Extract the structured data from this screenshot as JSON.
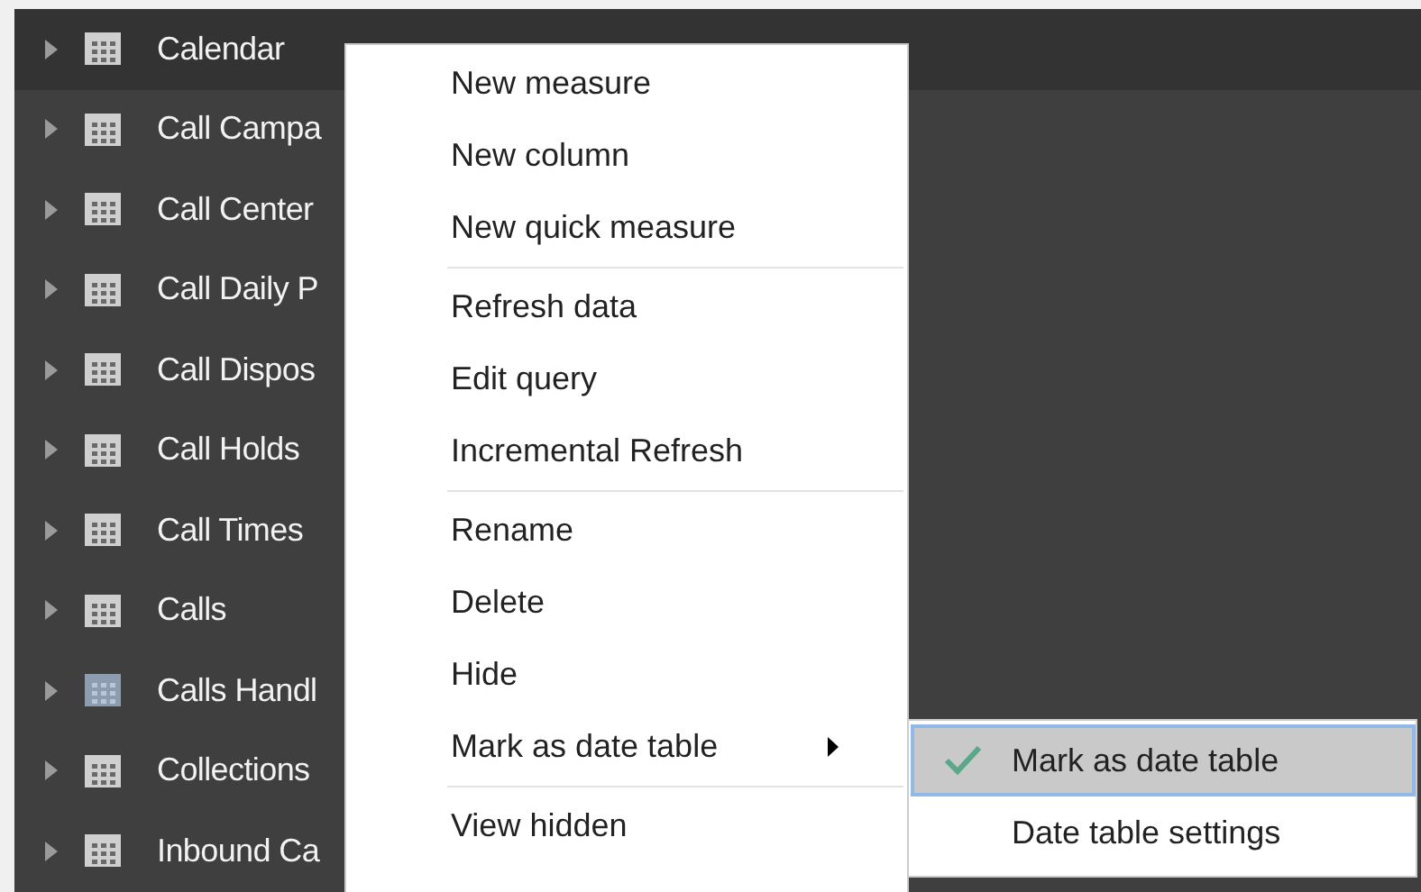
{
  "tables": [
    {
      "name": "Calendar",
      "selected": true,
      "hidden": false
    },
    {
      "name": "Call Campa",
      "selected": false,
      "hidden": false
    },
    {
      "name": "Call Center",
      "selected": false,
      "hidden": false
    },
    {
      "name": "Call Daily P",
      "selected": false,
      "hidden": false
    },
    {
      "name": "Call Dispos",
      "selected": false,
      "hidden": false
    },
    {
      "name": "Call Holds",
      "selected": false,
      "hidden": false
    },
    {
      "name": "Call Times",
      "selected": false,
      "hidden": false
    },
    {
      "name": "Calls",
      "selected": false,
      "hidden": false
    },
    {
      "name": "Calls Handl",
      "selected": false,
      "hidden": true
    },
    {
      "name": "Collections",
      "selected": false,
      "hidden": false
    },
    {
      "name": "Inbound Ca",
      "selected": false,
      "hidden": false
    }
  ],
  "context_menu": {
    "groups": [
      [
        {
          "label": "New measure",
          "has_submenu": false
        },
        {
          "label": "New column",
          "has_submenu": false
        },
        {
          "label": "New quick measure",
          "has_submenu": false
        }
      ],
      [
        {
          "label": "Refresh data",
          "has_submenu": false
        },
        {
          "label": "Edit query",
          "has_submenu": false
        },
        {
          "label": "Incremental Refresh",
          "has_submenu": false
        }
      ],
      [
        {
          "label": "Rename",
          "has_submenu": false
        },
        {
          "label": "Delete",
          "has_submenu": false
        },
        {
          "label": "Hide",
          "has_submenu": false
        },
        {
          "label": "Mark as date table",
          "has_submenu": true
        }
      ],
      [
        {
          "label": "View hidden",
          "has_submenu": false
        }
      ]
    ]
  },
  "submenu": {
    "items": [
      {
        "label": "Mark as date table",
        "checked": true,
        "selected": true
      },
      {
        "label": "Date table settings",
        "checked": false,
        "selected": false
      }
    ]
  }
}
